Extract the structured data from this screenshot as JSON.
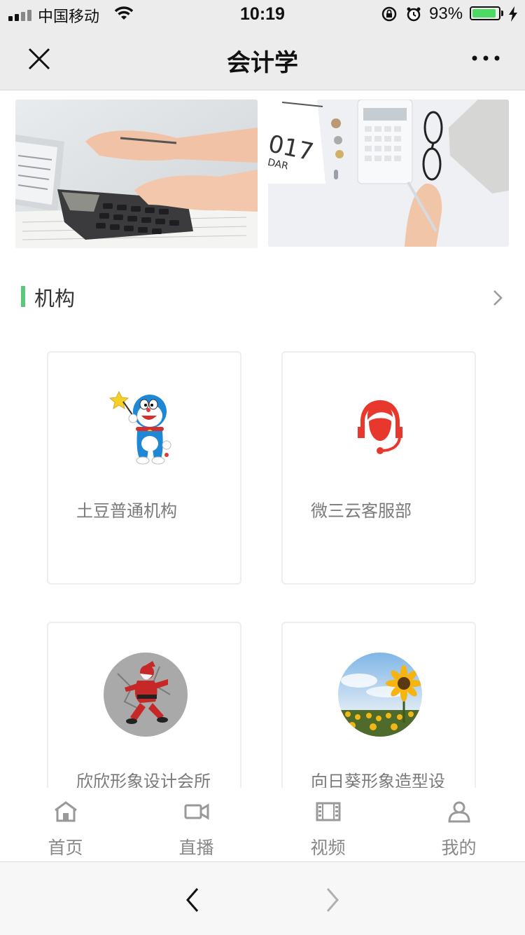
{
  "status_bar": {
    "carrier": "中国移动",
    "time": "10:19",
    "battery_percent": "93%",
    "battery_level": 0.93
  },
  "nav": {
    "title": "会计学"
  },
  "section": {
    "title": "机构"
  },
  "institutions": [
    {
      "name": "土豆普通机构",
      "logo": "doraemon-avatar"
    },
    {
      "name": "微三云客服部",
      "logo": "headset-avatar"
    },
    {
      "name": "欣欣形象设计会所",
      "logo": "santa-avatar"
    },
    {
      "name": "向日葵形象造型设",
      "logo": "sunflower-avatar"
    }
  ],
  "tabs": [
    {
      "label": "首页",
      "icon": "home-icon"
    },
    {
      "label": "直播",
      "icon": "video-camera-icon"
    },
    {
      "label": "视频",
      "icon": "film-icon"
    },
    {
      "label": "我的",
      "icon": "user-icon"
    }
  ],
  "colors": {
    "accent_green": "#5cc77a",
    "headset_red": "#e8372c",
    "battery_green": "#4cd964"
  }
}
